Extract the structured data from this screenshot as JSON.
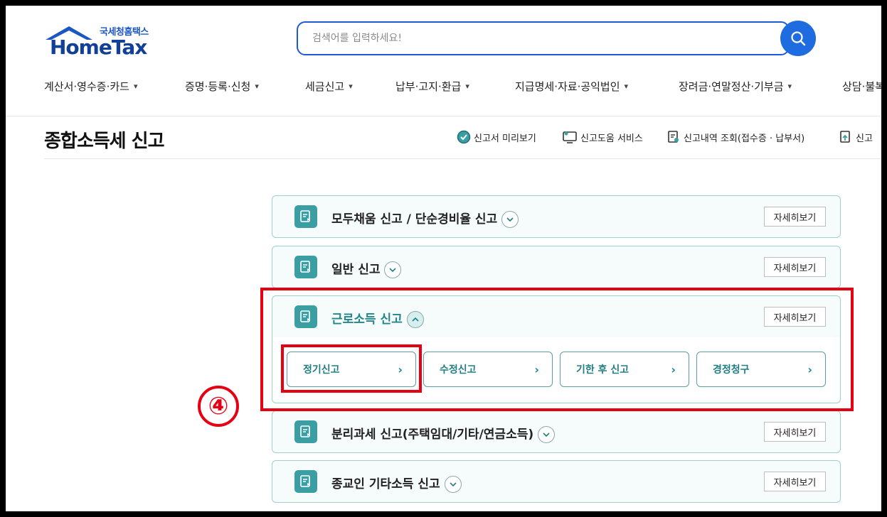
{
  "brand": {
    "korean_name": "국세청홈택스",
    "name": "HomeTax"
  },
  "search": {
    "placeholder": "검색어를 입력하세요!"
  },
  "gnb": [
    {
      "label": "계산서·영수증·카드"
    },
    {
      "label": "증명·등록·신청"
    },
    {
      "label": "세금신고"
    },
    {
      "label": "납부·고지·환급"
    },
    {
      "label": "지급명세·자료·공익법인"
    },
    {
      "label": "장려금·연말정산·기부금"
    },
    {
      "label": "상담·불복"
    }
  ],
  "page": {
    "title": "종합소득세 신고"
  },
  "utilities": [
    {
      "label": "신고서 미리보기",
      "icon": "check-circle-icon"
    },
    {
      "label": "신고도움 서비스",
      "icon": "monitor-icon"
    },
    {
      "label": "신고내역 조회(접수증 · 납부서)",
      "icon": "document-search-icon"
    },
    {
      "label": "신고",
      "icon": "upload-document-icon"
    }
  ],
  "accordion": [
    {
      "title": "모두채움 신고 / 단순경비율 신고",
      "detail": "자세히보기",
      "expanded": false
    },
    {
      "title": "일반 신고",
      "detail": "자세히보기",
      "expanded": false
    },
    {
      "title": "근로소득 신고",
      "detail": "자세히보기",
      "expanded": true,
      "sub_buttons": [
        "정기신고",
        "수정신고",
        "기한 후 신고",
        "경정청구"
      ]
    },
    {
      "title": "분리과세 신고(주택임대/기타/연금소득)",
      "detail": "자세히보기",
      "expanded": false
    },
    {
      "title": "종교인 기타소득 신고",
      "detail": "자세히보기",
      "expanded": false
    }
  ],
  "annotation": {
    "step": "④",
    "highlight_color": "#e60012"
  },
  "colors": {
    "brand_blue": "#1d5ad8",
    "teal": "#3a9ea3",
    "active_text": "#22878c"
  }
}
